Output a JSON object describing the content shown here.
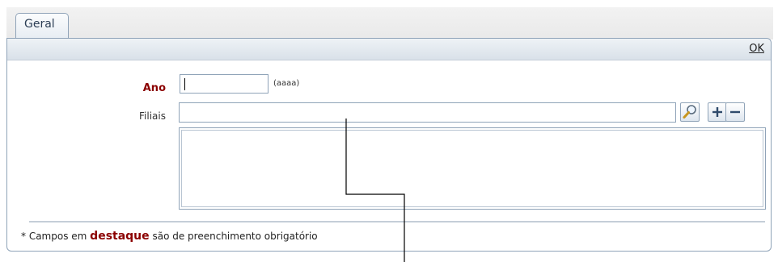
{
  "tabs": [
    {
      "label": "Geral"
    }
  ],
  "toolbar": {
    "ok_label": "OK"
  },
  "form": {
    "ano": {
      "label": "Ano",
      "value": "",
      "format_hint": "(aaaa)"
    },
    "filiais": {
      "label": "Filiais",
      "value": ""
    }
  },
  "footnote": {
    "prefix": "* Campos em",
    "highlight": "destaque",
    "suffix": "são de preenchimento obrigatório"
  },
  "icons": {
    "search": "magnifier-icon",
    "add": "plus-icon",
    "remove": "minus-icon"
  },
  "colors": {
    "required_label": "#8b0000",
    "border": "#8fa3b8",
    "toolbar": "#d9e1e9"
  }
}
